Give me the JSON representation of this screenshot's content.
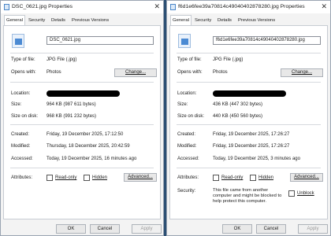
{
  "left": {
    "title": "DSC_0621.jpg Properties",
    "tabs": [
      "General",
      "Security",
      "Details",
      "Previous Versions"
    ],
    "file_name": "DSC_0621.jpg",
    "type_label": "Type of file:",
    "type_value": "JPG File (.jpg)",
    "opens_label": "Opens with:",
    "opens_value": "Photos",
    "change_label": "Change...",
    "location_label": "Location:",
    "size_label": "Size:",
    "size_value": "964 KB (987 611 bytes)",
    "disk_label": "Size on disk:",
    "disk_value": "968 KB (991 232 bytes)",
    "created_label": "Created:",
    "created_value": "Friday, 19 December 2025, 17:12:50",
    "modified_label": "Modified:",
    "modified_value": "Thursday, 18 December 2025, 20:42:59",
    "accessed_label": "Accessed:",
    "accessed_value": "Today, 19 December 2025, 16 minutes ago",
    "attributes_label": "Attributes:",
    "readonly_label": "Read-only",
    "hidden_label": "Hidden",
    "advanced_label": "Advanced...",
    "ok_label": "OK",
    "cancel_label": "Cancel",
    "apply_label": "Apply"
  },
  "right": {
    "title": "f6d1e6fee39a70814c49040402878280.jpg Properties",
    "tabs": [
      "General",
      "Security",
      "Details",
      "Previous Versions"
    ],
    "file_name": "f6d1e6fee39a70814c49040402878280.jpg",
    "type_label": "Type of file:",
    "type_value": "JPG File (.jpg)",
    "opens_label": "Opens with:",
    "opens_value": "Photos",
    "change_label": "Change...",
    "location_label": "Location:",
    "size_label": "Size:",
    "size_value": "436 KB (447 302 bytes)",
    "disk_label": "Size on disk:",
    "disk_value": "440 KB (450 560 bytes)",
    "created_label": "Created:",
    "created_value": "Friday, 19 December 2025, 17:26:27",
    "modified_label": "Modified:",
    "modified_value": "Friday, 19 December 2025, 17:26:27",
    "accessed_label": "Accessed:",
    "accessed_value": "Today, 19 December 2025, 3 minutes ago",
    "attributes_label": "Attributes:",
    "readonly_label": "Read-only",
    "hidden_label": "Hidden",
    "advanced_label": "Advanced...",
    "security_label": "Security:",
    "security_text": "This file came from another computer and might be blocked to help protect this computer.",
    "unblock_label": "Unblock",
    "ok_label": "OK",
    "cancel_label": "Cancel",
    "apply_label": "Apply"
  },
  "icons": {
    "close": "close-icon",
    "file": "image-file-icon",
    "app": "properties-icon"
  },
  "colors": {
    "window_bg": "#f3f3f3",
    "panel_bg": "#ffffff",
    "accent": "#4b8ad3",
    "redaction": "#000000"
  }
}
